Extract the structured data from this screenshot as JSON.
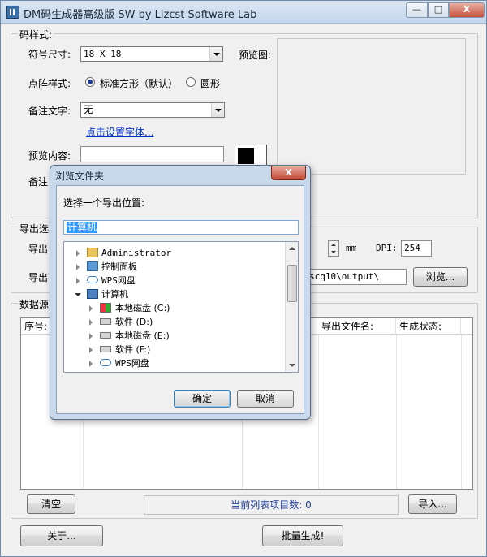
{
  "window": {
    "title": "DM码生成器高级版 SW  by Lizcst Software Lab",
    "min_glyph": "—",
    "max_glyph": "□",
    "close_glyph": "X"
  },
  "code_style": {
    "group_title": "码样式:",
    "symbol_size_label": "符号尺寸:",
    "symbol_size_value": "18 X 18",
    "preview_label": "预览图:",
    "dot_style_label": "点阵样式:",
    "dot_style_options": [
      "标准方形（默认）",
      "圆形"
    ],
    "dot_style_selected": "标准方形（默认）",
    "note_text_label": "备注文字:",
    "note_text_value": "无",
    "font_link": "点击设置字体...",
    "preview_content_label": "预览内容:",
    "preview_content_value": "",
    "note_label_partial": "备注"
  },
  "export": {
    "group_title_partial": "导出选",
    "export_label_partial": "导出",
    "export_label2_partial": "导出",
    "unit": "mm",
    "dpi_label": "DPI:",
    "dpi_value": "254",
    "path_value": "scq10\\output\\",
    "browse_button": "浏览..."
  },
  "data_source": {
    "group_title_partial": "数据源",
    "columns": [
      "序号:",
      "导出文件名:",
      "生成状态:"
    ]
  },
  "bottom": {
    "clear_button": "清空",
    "count_text": "当前列表项目数: 0",
    "import_button": "导入...",
    "about_button": "关于...",
    "batch_button": "批量生成!"
  },
  "dialog": {
    "title": "浏览文件夹",
    "close_glyph": "X",
    "prompt": "选择一个导出位置:",
    "selected_path": "计算机",
    "tree": [
      {
        "label": "Administrator",
        "icon": "user-folder-icon",
        "indent": 0,
        "expander": "collapsed"
      },
      {
        "label": "控制面板",
        "icon": "control-panel-icon",
        "indent": 0,
        "expander": "collapsed"
      },
      {
        "label": "WPS网盘",
        "icon": "cloud-icon",
        "indent": 0,
        "expander": "collapsed"
      },
      {
        "label": "计算机",
        "icon": "computer-icon",
        "indent": 0,
        "expander": "expanded"
      },
      {
        "label": "本地磁盘 (C:)",
        "icon": "windows-drive-icon",
        "indent": 1,
        "expander": "collapsed"
      },
      {
        "label": "软件 (D:)",
        "icon": "drive-icon",
        "indent": 1,
        "expander": "collapsed"
      },
      {
        "label": "本地磁盘 (E:)",
        "icon": "drive-icon",
        "indent": 1,
        "expander": "collapsed"
      },
      {
        "label": "软件 (F:)",
        "icon": "drive-icon",
        "indent": 1,
        "expander": "collapsed"
      },
      {
        "label": "WPS网盘",
        "icon": "cloud-icon",
        "indent": 1,
        "expander": "collapsed"
      }
    ],
    "ok_button": "确定",
    "cancel_button": "取消"
  }
}
